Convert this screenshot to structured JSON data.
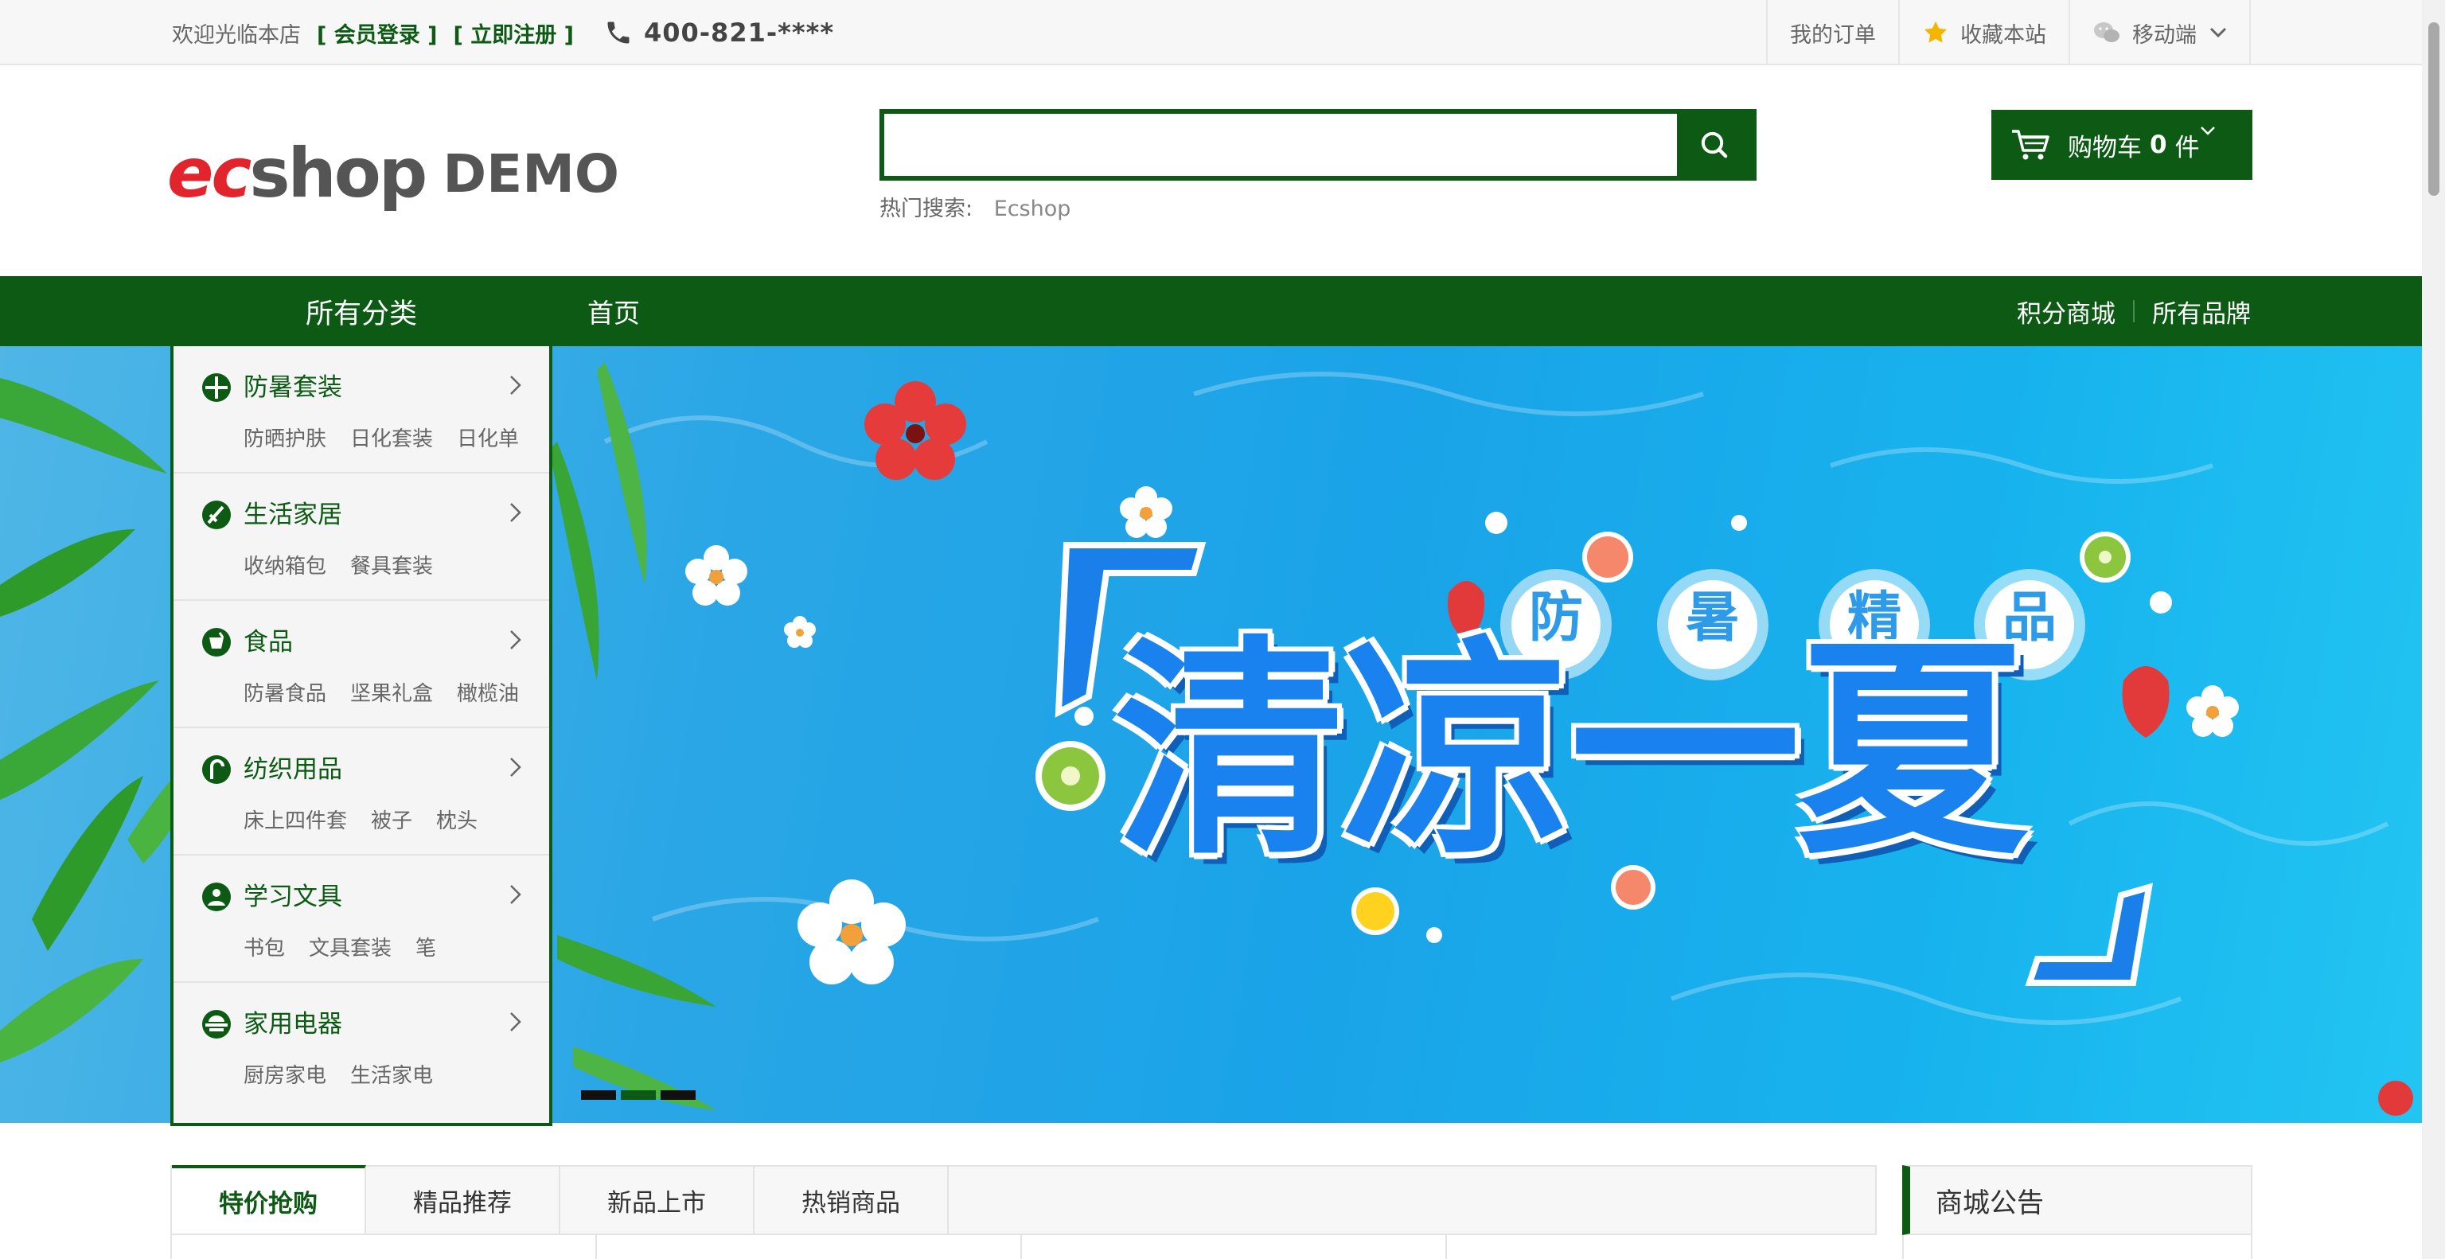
{
  "topbar": {
    "welcome": "欢迎光临本店",
    "login": "[ 会员登录 ]",
    "register": "[ 立即注册 ]",
    "phone": "400-821-****",
    "my_orders": "我的订单",
    "favorite": "收藏本站",
    "mobile": "移动端"
  },
  "header": {
    "logo_ec": "ec",
    "logo_shop": "shop",
    "logo_demo": "DEMO",
    "search_value": "",
    "hot_label": "热门搜索:",
    "hot_items": [
      "Ecshop"
    ],
    "cart_label": "购物车",
    "cart_count": "0",
    "cart_unit": "件"
  },
  "nav": {
    "all_categories": "所有分类",
    "home": "首页",
    "points_mall": "积分商城",
    "all_brands": "所有品牌"
  },
  "categories": [
    {
      "title": "防暑套装",
      "icon": "sun-protection-icon",
      "subs": [
        "防晒护肤",
        "日化套装",
        "日化单"
      ]
    },
    {
      "title": "生活家居",
      "icon": "home-living-icon",
      "subs": [
        "收纳箱包",
        "餐具套装"
      ]
    },
    {
      "title": "食品",
      "icon": "food-icon",
      "subs": [
        "防暑食品",
        "坚果礼盒",
        "橄榄油"
      ]
    },
    {
      "title": "纺织用品",
      "icon": "textile-icon",
      "subs": [
        "床上四件套",
        "被子",
        "枕头"
      ]
    },
    {
      "title": "学习文具",
      "icon": "stationery-icon",
      "subs": [
        "书包",
        "文具套装",
        "笔"
      ]
    },
    {
      "title": "家用电器",
      "icon": "appliance-icon",
      "subs": [
        "厨房家电",
        "生活家电"
      ]
    }
  ],
  "banner": {
    "headline": "清凉一夏",
    "tagline": [
      "防",
      "暑",
      "精",
      "品"
    ],
    "slides": 3,
    "active_slide": 2
  },
  "tabs": [
    "特价抢购",
    "精品推荐",
    "新品上市",
    "热销商品"
  ],
  "active_tab": 0,
  "notice_title": "商城公告",
  "colors": {
    "brand_green": "#0c5a14",
    "logo_red": "#e2242c",
    "banner_blue": "#1aa3e8"
  }
}
